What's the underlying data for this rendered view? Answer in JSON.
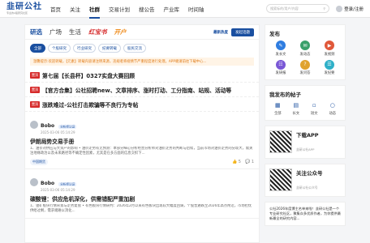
{
  "header": {
    "logo_title": "韭研公社",
    "logo_sub": "专业的A股研究社区",
    "nav": [
      "首页",
      "关注",
      "社群",
      "交易计划",
      "搜公告",
      "产业库",
      "时间轴"
    ],
    "active_nav": "社群",
    "search_placeholder": "搜索标的/用户/内容",
    "login_label": "登录/注册"
  },
  "main": {
    "tabs": [
      "研选",
      "广场",
      "生活",
      "红宝书",
      "开户"
    ],
    "latest_link": "最新热度",
    "post_button": "发起话题",
    "chips": [
      "全部",
      "个股研究",
      "行业研究",
      "纪要转载",
      "股民交流"
    ],
    "notice": "温馨提示:欢迎转载，【元素】转载内容请注明来源，违规者将视情节严重程度进行处理。APP端请前往下载中心...",
    "pinned": [
      {
        "tag": "置顶",
        "title": "第七届【长县杯】0327实盘大赛回顾"
      },
      {
        "tag": "置顶",
        "title": "【官方合集】公社招聘new、文章排序、涨时打动、工分指南、站规、活动等"
      },
      {
        "tag": "置顶",
        "title": "涨跌难过-公社打击欺骗等不良行为专帖"
      }
    ],
    "posts": [
      {
        "author": "Bobo",
        "badge": "分析师认证",
        "time": "2025-03-06 05:14:29",
        "title": "伊朗局势交易手册",
        "body": "1、油价对供应与大资产的影响 • 油价走势有无预测：本部分细心分析经营分析师对油价走势的判断与后续，当前市场对油价走势的分歧大，需关注地缘政治以及未来路径等不确定性因素，尤其是在多方面的信息交织下...",
        "source": "中国期货",
        "likes": "5",
        "comments": "1"
      },
      {
        "author": "Bobo",
        "badge": "分析师认证",
        "time": "2025-03-06 05:14:29",
        "title": "碳酸锂：供应危机深化，供需错配严重加剧",
        "body": "1、锂矿板块行情背景与走势复盘 • 有色板块行情研判：2026年2月以来有色板块出现较大幅度回调，个股普遍跌至2026年高点附近，市场担忧供给过剩，需求端难以消化...",
        "source": "",
        "likes": "",
        "comments": ""
      }
    ]
  },
  "sidebar": {
    "publish_title": "发布",
    "publish_items": [
      {
        "label": "发长文",
        "color": "#2f7de0"
      },
      {
        "label": "发动态",
        "color": "#3aa06b"
      },
      {
        "label": "发视频",
        "color": "#e0583a"
      },
      {
        "label": "发研报",
        "color": "#7a58d6"
      },
      {
        "label": "发问答",
        "color": "#e0a32f"
      },
      {
        "label": "发纪要",
        "color": "#2fb0c8"
      }
    ],
    "mine_title": "我发布的帖子",
    "mine_items": [
      "全部",
      "长文",
      "短文",
      "动态"
    ],
    "app_title": "下载APP",
    "app_sub": "韭研公社APP",
    "wx_title": "关注公众号",
    "wx_sub": "韭研公社公众号",
    "about": "公社2026年度博主名单来啦！韭研公社是一个专业研究社区，聚集众多优质作者，为你提供最新最全的研究内容..."
  }
}
